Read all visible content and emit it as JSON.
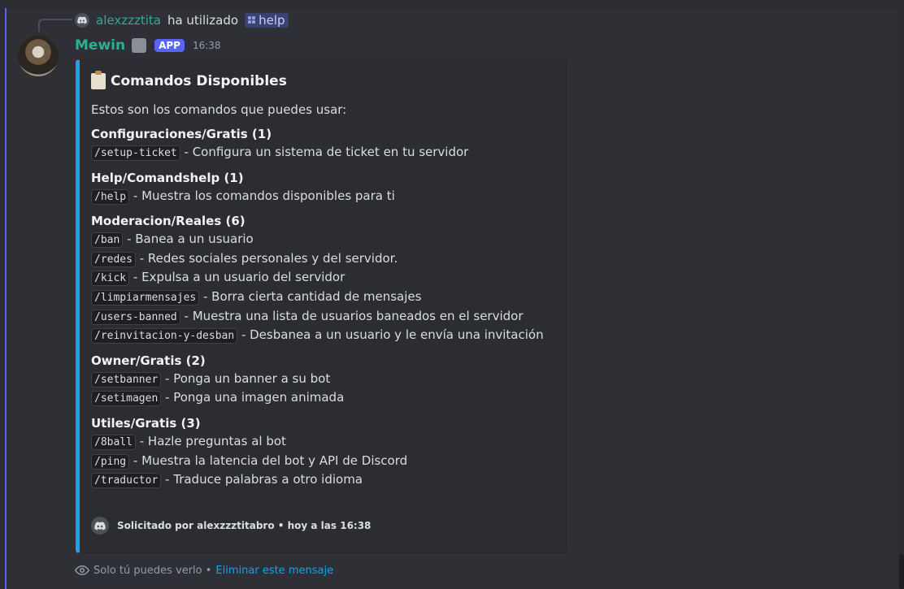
{
  "reply": {
    "user": "alexzzztita",
    "action": "ha utilizado",
    "command": "help"
  },
  "message": {
    "author": "Mewin",
    "badge": "APP",
    "time": "16:38"
  },
  "embed": {
    "title": "Comandos Disponibles",
    "description": "Estos son los comandos que puedes usar:",
    "sections": [
      {
        "title": "Configuraciones/Gratis (1)",
        "commands": [
          {
            "cmd": "/setup-ticket",
            "desc": " - Configura un sistema de ticket en tu servidor"
          }
        ]
      },
      {
        "title": "Help/Comandshelp (1)",
        "commands": [
          {
            "cmd": "/help",
            "desc": " - Muestra los comandos disponibles para ti"
          }
        ]
      },
      {
        "title": "Moderacion/Reales (6)",
        "commands": [
          {
            "cmd": "/ban",
            "desc": " - Banea a un usuario"
          },
          {
            "cmd": "/redes",
            "desc": " - Redes sociales personales y del servidor."
          },
          {
            "cmd": "/kick",
            "desc": " - Expulsa a un usuario del servidor"
          },
          {
            "cmd": "/limpiarmensajes",
            "desc": " - Borra cierta cantidad de mensajes"
          },
          {
            "cmd": "/users-banned",
            "desc": " - Muestra una lista de usuarios baneados en el servidor"
          },
          {
            "cmd": "/reinvitacion-y-desban",
            "desc": " - Desbanea a un usuario y le envía una invitación"
          }
        ]
      },
      {
        "title": "Owner/Gratis (2)",
        "commands": [
          {
            "cmd": "/setbanner",
            "desc": " - Ponga un banner a su bot"
          },
          {
            "cmd": "/setimagen",
            "desc": " - Ponga una imagen animada"
          }
        ]
      },
      {
        "title": "Utiles/Gratis (3)",
        "commands": [
          {
            "cmd": "/8ball",
            "desc": " - Hazle preguntas al bot"
          },
          {
            "cmd": "/ping",
            "desc": " - Muestra la latencia del bot y API de Discord"
          },
          {
            "cmd": "/traductor",
            "desc": " - Traduce palabras a otro idioma"
          }
        ]
      }
    ],
    "footer": "Solicitado por alexzzztitabro • hoy a las 16:38"
  },
  "ephemeral": {
    "text": "Solo tú puedes verlo •",
    "delete_label": "Eliminar este mensaje"
  },
  "colors": {
    "accent": "#5865f2",
    "embed_border": "#1e9ff2",
    "username": "#2bb08e",
    "link": "#00a8fc"
  }
}
